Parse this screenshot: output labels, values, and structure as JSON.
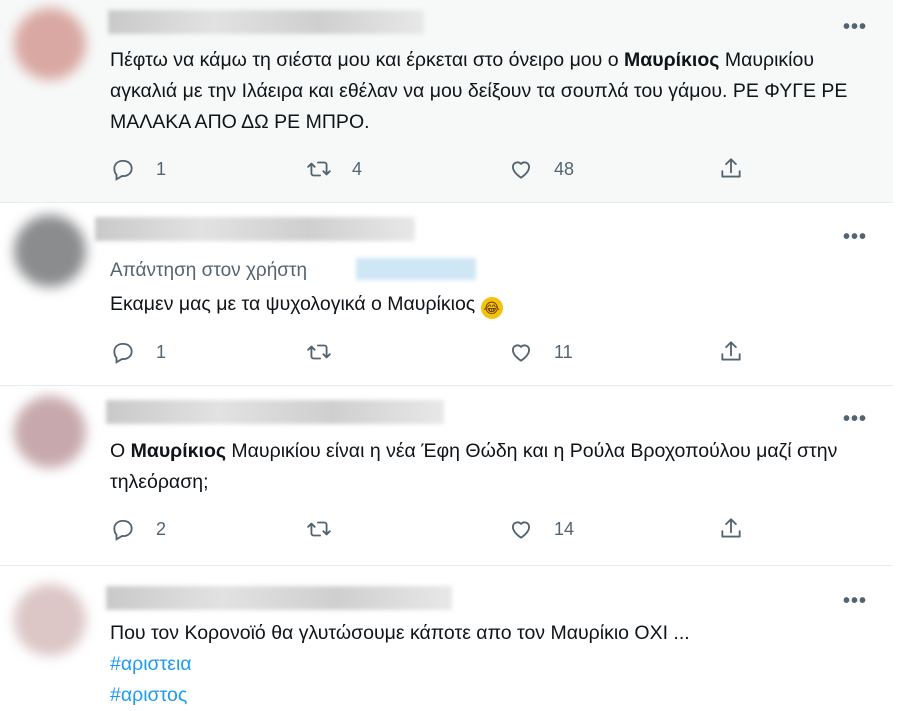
{
  "tweets": [
    {
      "text_pre": "Πέφτω να κάμω τη σιέστα μου και έρκεται στο όνειρο μου ο ",
      "text_bold": "Μαυρίκιος",
      "text_post": " Μαυρικίου αγκαλιά με την Ιλάειρα και εθέλαν να μου δείξουν τα σουπλά του γάμου. ΡΕ ΦΥΓΕ ΡΕ ΜΑΛΑΚΑ ΑΠΟ ΔΩ ΡΕ ΜΠΡΟ.",
      "replies": "1",
      "retweets": "4",
      "likes": "48"
    },
    {
      "reply_to_label": "Απάντηση στον χρήστη",
      "text": "Εκαμεν μας με τα ψυχολογικά ο Μαυρίκιος",
      "emoji": "🤣",
      "replies": "1",
      "retweets": "",
      "likes": "11"
    },
    {
      "text_pre": "Ο ",
      "text_bold": "Μαυρίκιος",
      "text_post": " Μαυρικίου είναι η νέα Έφη Θώδη και η Ρούλα Βροχοπούλου μαζί στην τηλεόραση;",
      "replies": "2",
      "retweets": "",
      "likes": "14"
    },
    {
      "text": "Που τον Κορονοϊό θα γλυτώσουμε κάποτε απο τον Μαυρίκιο ΟΧΙ ...",
      "hashtags": [
        "#αριστεια",
        "#αριστος"
      ]
    }
  ],
  "more_label": "•••",
  "colors": {
    "accent": "#1d9bf0",
    "muted": "#536471",
    "divider": "#e6ecf0"
  },
  "icons": [
    "reply-icon",
    "retweet-icon",
    "like-icon",
    "share-icon",
    "more-icon",
    "rofl-emoji"
  ]
}
